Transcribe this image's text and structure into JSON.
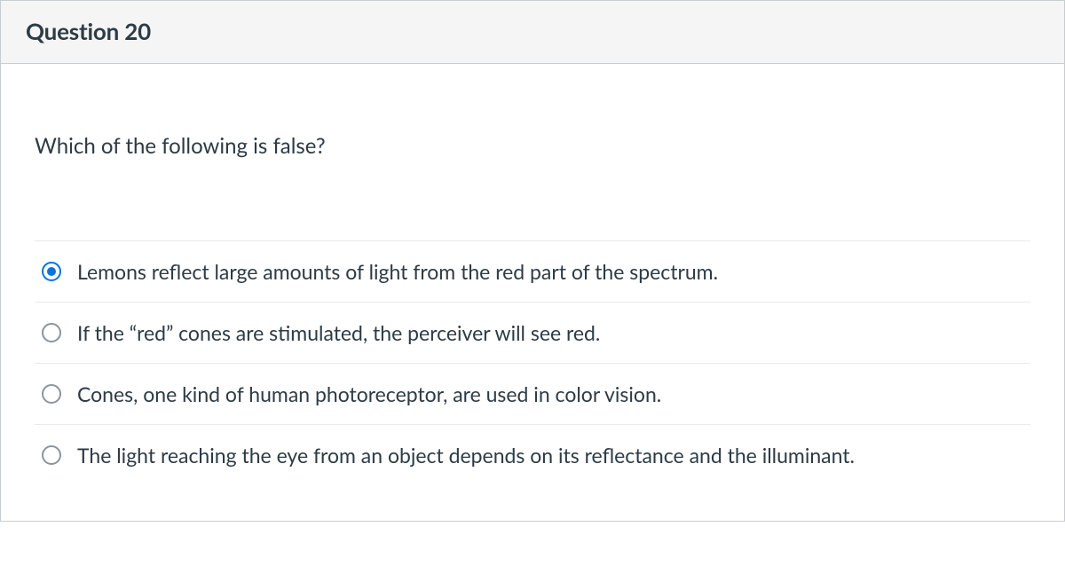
{
  "question": {
    "title": "Question 20",
    "prompt": "Which of the following is false?",
    "selected_index": 0,
    "options": [
      "Lemons reflect large amounts of light from the red part of the spectrum.",
      "If the “red” cones are stimulated, the perceiver will see red.",
      "Cones, one kind of human photoreceptor, are used in color vision.",
      "The light reaching the eye from an object depends on its reflectance and the illuminant."
    ]
  }
}
